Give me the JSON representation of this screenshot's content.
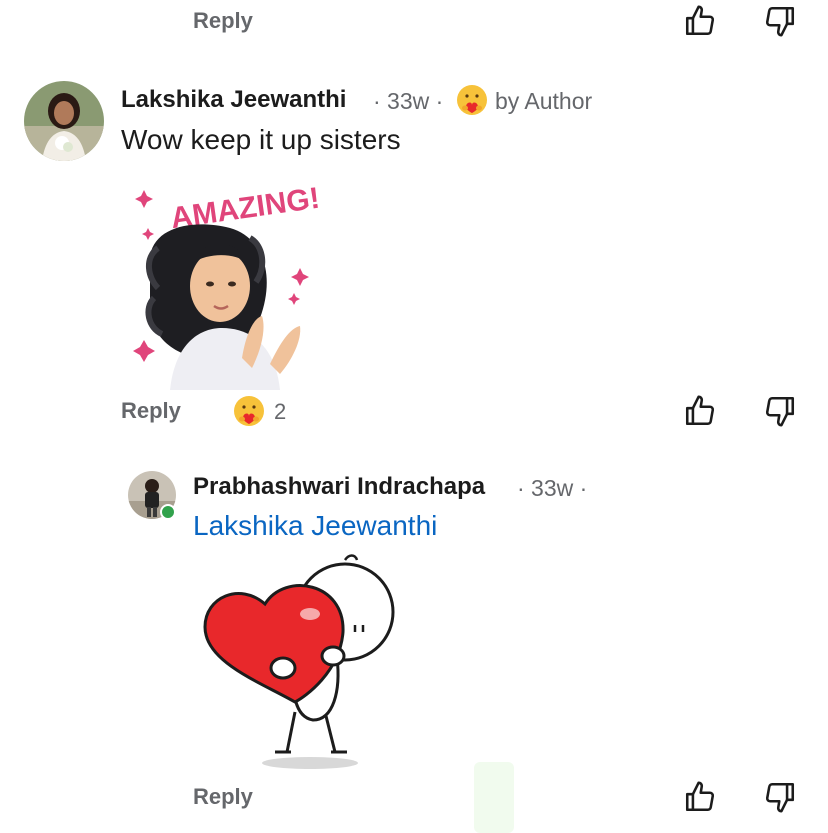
{
  "thread": [
    {
      "reply_label": "Reply"
    },
    {
      "author": "Lakshika Jeewanthi",
      "time": "· 33w ·",
      "reaction_icon": "heart-hug-emoji",
      "badge": "by Author",
      "text": "Wow keep it up sisters",
      "sticker": {
        "caption": "AMAZING!",
        "icon": "amazing-clapping-avatar-sticker"
      },
      "reply_label": "Reply",
      "reaction_count": "2"
    },
    {
      "author": "Prabhashwari Indrachapa",
      "time": "· 33w ·",
      "online": true,
      "mention": "Lakshika Jeewanthi",
      "sticker": {
        "icon": "stick-figure-heart-hug-sticker"
      },
      "reply_label": "Reply"
    }
  ],
  "colors": {
    "link": "#0a66c2",
    "muted": "#65676b",
    "heart": "#e8282b",
    "sparkle": "#e0457b",
    "online": "#31a24c"
  }
}
